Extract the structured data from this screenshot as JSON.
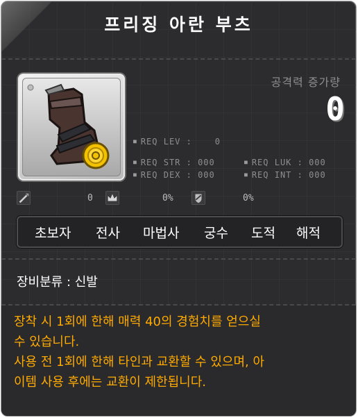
{
  "item": {
    "name": "프리징 아란 부츠",
    "attack_label": "공격력 증가량",
    "attack_value": "0"
  },
  "requirements": {
    "lev": "REQ LEV :    0",
    "str": "REQ STR : 000",
    "dex": "REQ DEX : 000",
    "luk": "REQ LUK : 000",
    "int": "REQ INT : 000"
  },
  "stats": [
    {
      "icon": "sword-icon",
      "value": "0"
    },
    {
      "icon": "crown-icon",
      "value": "0%"
    },
    {
      "icon": "shield-icon",
      "value": "0%"
    }
  ],
  "jobs": [
    "초보자",
    "전사",
    "마법사",
    "궁수",
    "도적",
    "해적"
  ],
  "category": "장비분류 : 신발",
  "description": "장착 시 1회에 한해 매력 40의 경험치를 얻으실\n 수 있습니다.\n 사용 전 1회에 한해 타인과 교환할 수 있으며, 아\n이템 사용 후에는 교환이 제한됩니다.",
  "colors": {
    "description": "#ffaa00",
    "background": "#2c2c2e",
    "coin": "#f2c200"
  }
}
